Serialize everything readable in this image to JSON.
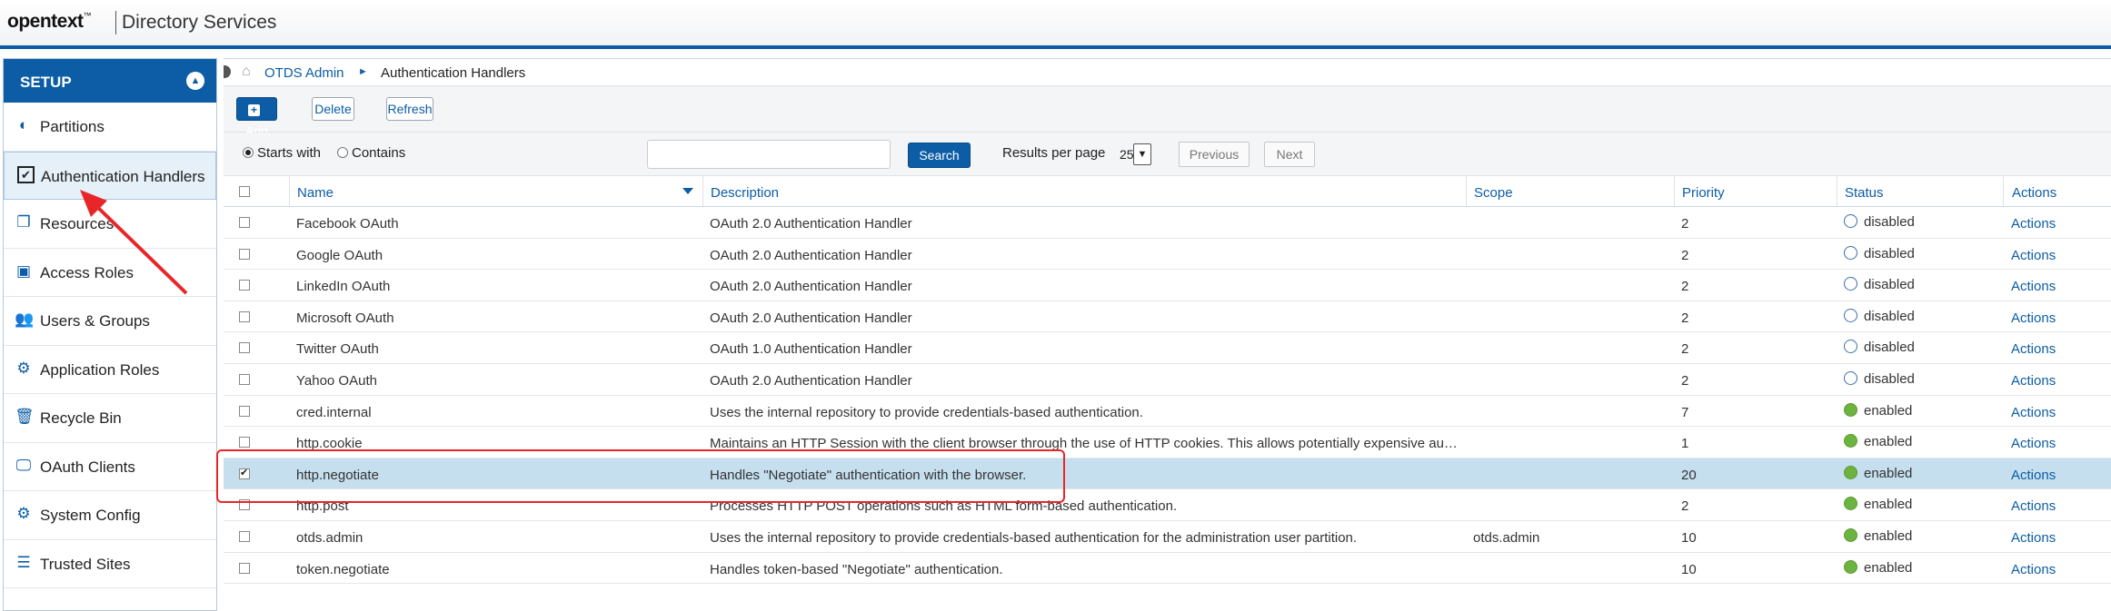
{
  "header": {
    "logo": "opentext",
    "logo_tm": "™",
    "product": "Directory Services"
  },
  "sidebar": {
    "title": "SETUP",
    "items": [
      {
        "label": "Partitions",
        "icon": "partitions-icon",
        "glyph": "◐"
      },
      {
        "label": "Authentication Handlers",
        "icon": "checkbox-icon",
        "glyph": "✔",
        "active": true
      },
      {
        "label": "Resources",
        "icon": "resources-icon",
        "glyph": "❐"
      },
      {
        "label": "Access Roles",
        "icon": "access-roles-icon",
        "glyph": "▣"
      },
      {
        "label": "Users & Groups",
        "icon": "users-icon",
        "glyph": "👥"
      },
      {
        "label": "Application Roles",
        "icon": "gear-icon",
        "glyph": "⚙"
      },
      {
        "label": "Recycle Bin",
        "icon": "trash-icon",
        "glyph": "🗑"
      },
      {
        "label": "OAuth Clients",
        "icon": "monitor-icon",
        "glyph": "🖵"
      },
      {
        "label": "System Config",
        "icon": "gears-icon",
        "glyph": "⚙"
      },
      {
        "label": "Trusted Sites",
        "icon": "list-icon",
        "glyph": "☰"
      }
    ]
  },
  "breadcrumb": {
    "root": "OTDS Admin",
    "current": "Authentication Handlers",
    "separator": "►"
  },
  "toolbar": {
    "add": "Add",
    "delete": "Delete",
    "refresh": "Refresh"
  },
  "filter": {
    "starts_with": "Starts with",
    "contains": "Contains",
    "search_value": "",
    "search_button": "Search",
    "results_label": "Results per page",
    "results_value": "25",
    "previous": "Previous",
    "next": "Next"
  },
  "table": {
    "columns": {
      "name": "Name",
      "description": "Description",
      "scope": "Scope",
      "priority": "Priority",
      "status": "Status",
      "actions": "Actions"
    },
    "rows": [
      {
        "name": "Facebook OAuth",
        "description": "OAuth 2.0 Authentication Handler",
        "scope": "",
        "priority": "2",
        "status": "disabled",
        "actions": "Actions"
      },
      {
        "name": "Google OAuth",
        "description": "OAuth 2.0 Authentication Handler",
        "scope": "",
        "priority": "2",
        "status": "disabled",
        "actions": "Actions"
      },
      {
        "name": "LinkedIn OAuth",
        "description": "OAuth 2.0 Authentication Handler",
        "scope": "",
        "priority": "2",
        "status": "disabled",
        "actions": "Actions"
      },
      {
        "name": "Microsoft OAuth",
        "description": "OAuth 2.0 Authentication Handler",
        "scope": "",
        "priority": "2",
        "status": "disabled",
        "actions": "Actions"
      },
      {
        "name": "Twitter OAuth",
        "description": "OAuth 1.0 Authentication Handler",
        "scope": "",
        "priority": "2",
        "status": "disabled",
        "actions": "Actions"
      },
      {
        "name": "Yahoo OAuth",
        "description": "OAuth 2.0 Authentication Handler",
        "scope": "",
        "priority": "2",
        "status": "disabled",
        "actions": "Actions"
      },
      {
        "name": "cred.internal",
        "description": "Uses the internal repository to provide credentials-based authentication.",
        "scope": "",
        "priority": "7",
        "status": "enabled",
        "actions": "Actions"
      },
      {
        "name": "http.cookie",
        "description": "Maintains an HTTP Session with the client browser through the use of HTTP cookies. This allows potentially expensive au…",
        "scope": "",
        "priority": "1",
        "status": "enabled",
        "actions": "Actions"
      },
      {
        "name": "http.negotiate",
        "description": "Handles \"Negotiate\" authentication with the browser.",
        "scope": "",
        "priority": "20",
        "status": "enabled",
        "actions": "Actions",
        "selected": true
      },
      {
        "name": "http.post",
        "description": "Processes HTTP POST operations such as HTML form-based authentication.",
        "scope": "",
        "priority": "2",
        "status": "enabled",
        "actions": "Actions"
      },
      {
        "name": "otds.admin",
        "description": "Uses the internal repository to provide credentials-based authentication for the administration user partition.",
        "scope": "otds.admin",
        "priority": "10",
        "status": "enabled",
        "actions": "Actions"
      },
      {
        "name": "token.negotiate",
        "description": "Handles token-based \"Negotiate\" authentication.",
        "scope": "",
        "priority": "10",
        "status": "enabled",
        "actions": "Actions"
      }
    ]
  },
  "colors": {
    "brand": "#0c5da5",
    "enabled": "#6db33f",
    "selected_row": "#c5dfee",
    "annotation": "#e8262a"
  }
}
